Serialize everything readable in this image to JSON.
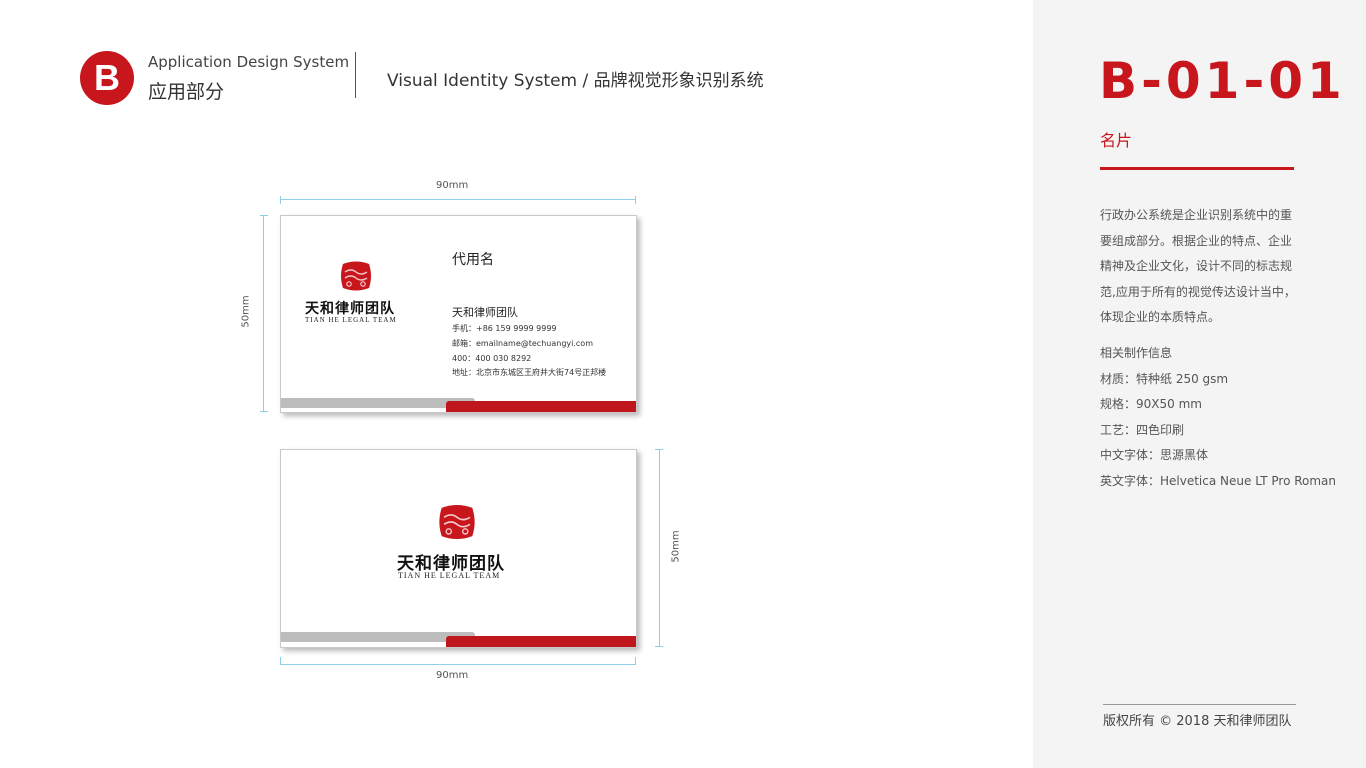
{
  "header": {
    "badge_letter": "B",
    "section_en": "Application Design System",
    "section_cn": "应用部分",
    "vis_title": "Visual Identity System / 品牌视觉形象识别系统"
  },
  "panel": {
    "code": "B-01-01",
    "section_name": "名片",
    "description_lines": [
      "行政办公系统是企业识别系统中的重",
      "要组成部分。根据企业的特点、企业",
      "精神及企业文化，设计不同的标志规",
      "范,应用于所有的视觉传达设计当中，",
      "体现企业的本质特点。"
    ],
    "spec_title": "相关制作信息",
    "specs": [
      "材质：特种纸 250 gsm",
      "规格：90X50 mm",
      "工艺：四色印刷",
      "中文字体：思源黑体",
      "英文字体：Helvetica Neue LT Pro Roman"
    ],
    "footer": "版权所有 © 2018   天和律师团队"
  },
  "card_front": {
    "logo_cn": "天和律师团队",
    "logo_en": "TIAN  HE  LEGAL  TEAM",
    "name": "代用名",
    "company": "天和律师团队",
    "phone": "手机：+86 159 9999 9999",
    "email": "邮箱：emailname@techuangyi.com",
    "hotline": "400：400 030 8292",
    "address": "地址：北京市东城区王府井大街74号正邦楼"
  },
  "card_back": {
    "logo_cn": "天和律师团队",
    "logo_en": "TIAN  HE  LEGAL  TEAM"
  },
  "dimensions": {
    "front_width": "90mm",
    "front_height": "50mm",
    "back_width": "90mm",
    "back_height": "50mm"
  },
  "colors": {
    "brand_red": "#c8161d",
    "stripe_gray": "#bdbdbd",
    "dimension_line": "#8fd0e8",
    "panel_bg": "#f4f4f4"
  },
  "icons": {
    "logo_mark": "red-seal-cloud-emblem"
  }
}
